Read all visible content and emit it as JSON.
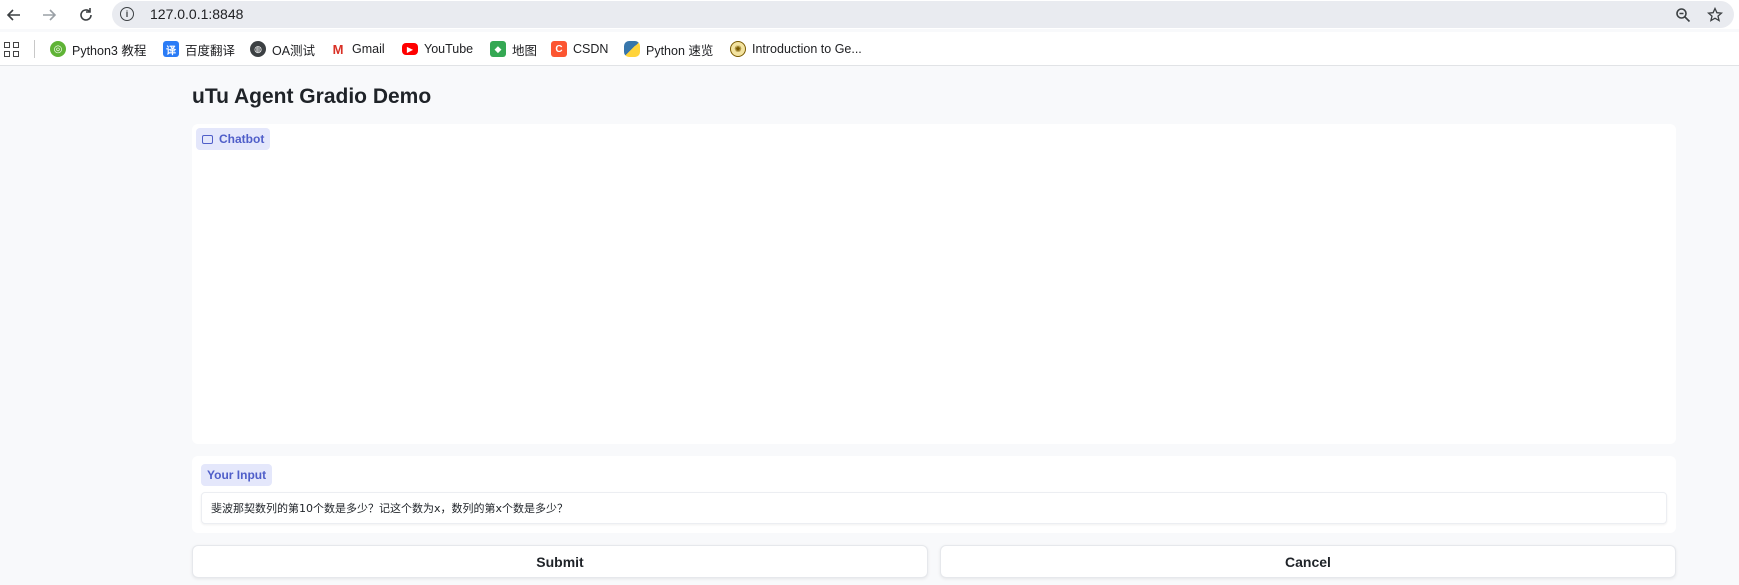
{
  "browser": {
    "url": "127.0.0.1:8848",
    "bookmarks": [
      {
        "label": "Python3 教程",
        "icon": "python-runoob-icon",
        "color": "#5fb336",
        "glyph": "◎"
      },
      {
        "label": "百度翻译",
        "icon": "baidu-translate-icon",
        "color": "#2b7cf6",
        "glyph": "译"
      },
      {
        "label": "OA测试",
        "icon": "globe-icon",
        "color": "#3c4043",
        "glyph": "●"
      },
      {
        "label": "Gmail",
        "icon": "gmail-icon",
        "color": "#ffffff",
        "glyph": "M"
      },
      {
        "label": "YouTube",
        "icon": "youtube-icon",
        "color": "#ff0000",
        "glyph": "▶"
      },
      {
        "label": "地图",
        "icon": "maps-icon",
        "color": "#34a853",
        "glyph": "◆"
      },
      {
        "label": "CSDN",
        "icon": "csdn-icon",
        "color": "#fc5531",
        "glyph": "C"
      },
      {
        "label": "Python 速览",
        "icon": "python-logo-icon",
        "color": "#3776ab",
        "glyph": "◐"
      },
      {
        "label": "Introduction to Ge...",
        "icon": "intro-site-icon",
        "color": "#c9a227",
        "glyph": "✺"
      }
    ]
  },
  "page": {
    "title": "uTu Agent Gradio Demo",
    "chatbot_label": "Chatbot",
    "input_label": "Your Input",
    "input_value": "斐波那契数列的第10个数是多少？记这个数为x，数列的第x个数是多少？",
    "submit_label": "Submit",
    "cancel_label": "Cancel"
  },
  "colors": {
    "accent": "#4f5ec9",
    "label_bg": "#e4e7fb",
    "page_bg": "#f8f9fb"
  }
}
